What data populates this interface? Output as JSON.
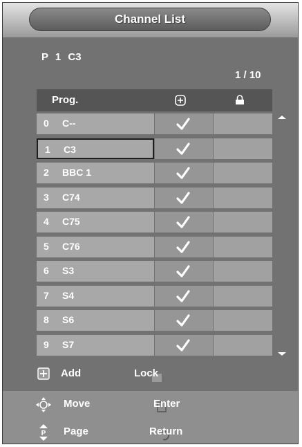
{
  "title": "Channel List",
  "current_channel": "P  1  C3",
  "page_indicator": "1 / 10",
  "header": {
    "prog": "Prog.",
    "add_icon": "add-icon",
    "lock_icon": "lock-icon"
  },
  "channels": [
    {
      "no": "0",
      "name": "C--",
      "added": true,
      "locked": false
    },
    {
      "no": "1",
      "name": "C3",
      "added": true,
      "locked": false,
      "selected": true
    },
    {
      "no": "2",
      "name": "BBC 1",
      "added": true,
      "locked": false
    },
    {
      "no": "3",
      "name": "C74",
      "added": true,
      "locked": false
    },
    {
      "no": "4",
      "name": "C75",
      "added": true,
      "locked": false
    },
    {
      "no": "5",
      "name": "C76",
      "added": true,
      "locked": false
    },
    {
      "no": "6",
      "name": "S3",
      "added": true,
      "locked": false
    },
    {
      "no": "7",
      "name": "S4",
      "added": true,
      "locked": false
    },
    {
      "no": "8",
      "name": "S6",
      "added": true,
      "locked": false
    },
    {
      "no": "9",
      "name": "S7",
      "added": true,
      "locked": false
    }
  ],
  "legend": {
    "add": "Add",
    "lock": "Lock"
  },
  "footer": {
    "move": "Move",
    "enter": "Enter",
    "page": "Page",
    "return": "Return"
  },
  "colors": {
    "background": "#727272",
    "row": "#a8a8a8",
    "header": "#555555",
    "footer": "#8f8f8f"
  }
}
